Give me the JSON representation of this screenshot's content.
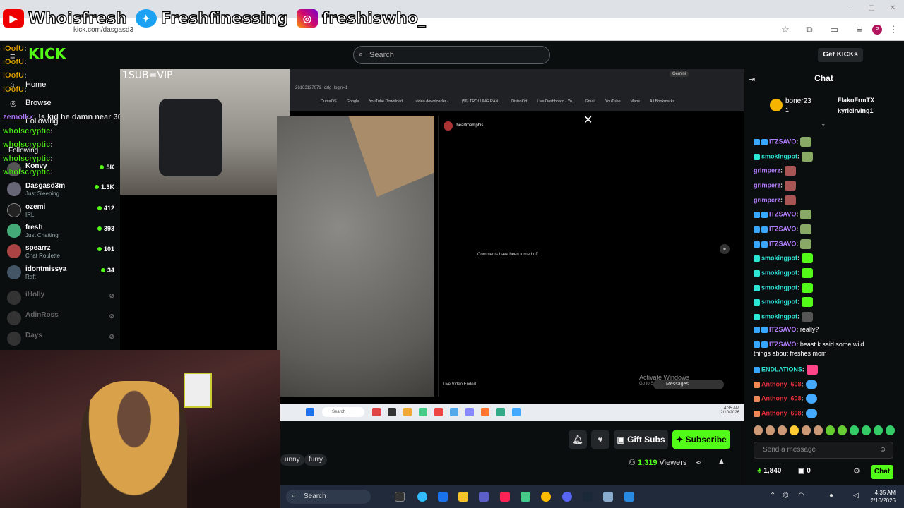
{
  "browser": {
    "url": "kick.com/dasgasd3",
    "profile_letter": "P"
  },
  "social": {
    "youtube": "Whoisfresh",
    "twitter": "Freshfinessing",
    "instagram": "freshiswho_"
  },
  "kick": {
    "search_placeholder": "Search",
    "get_kicks": "Get KICKs",
    "home": "Home",
    "browse": "Browse",
    "following": "Following"
  },
  "sidebar": {
    "channels": [
      {
        "name": "Konvy",
        "category": "",
        "viewers": "5K",
        "live": true
      },
      {
        "name": "Dasgasd3m",
        "category": "Just Sleeping",
        "viewers": "1.3K",
        "live": true
      },
      {
        "name": "ozemi",
        "category": "IRL",
        "viewers": "412",
        "live": true
      },
      {
        "name": "fresh",
        "category": "Just Chatting",
        "viewers": "393",
        "live": true
      },
      {
        "name": "spearrz",
        "category": "Chat Roulette",
        "viewers": "101",
        "live": true
      },
      {
        "name": "idontmissya",
        "category": "Raft",
        "viewers": "34",
        "live": true
      },
      {
        "name": "iHolly",
        "category": "",
        "viewers": "",
        "live": false
      },
      {
        "name": "AdinRoss",
        "category": "",
        "viewers": "",
        "live": false
      },
      {
        "name": "Days",
        "category": "",
        "viewers": "",
        "live": false
      }
    ]
  },
  "overlay_chat": [
    {
      "user": "iOofU",
      "text": ":"
    },
    {
      "user": "iOofU",
      "text": ":"
    },
    {
      "user": "iOofU",
      "text": ":"
    },
    {
      "user": "iOofU",
      "text": ":"
    },
    {
      "user": "zemolkx",
      "text": ": !s kid he damn near 30"
    },
    {
      "user": "wholscryptic",
      "text": ":"
    },
    {
      "user": "wholscryptic",
      "text": ":"
    },
    {
      "user": "wholscryptic",
      "text": ":"
    },
    {
      "user": "wholscryptic",
      "text": ":"
    }
  ],
  "video": {
    "overlay_text": "1SUB=VIP",
    "inner_url": "2616312707&_cslg_login=1",
    "bookmarks": [
      "DumaOS",
      "Google",
      "YouTube Download...",
      "video downloader -...",
      "(56) TROLLING RAN...",
      "DistroKid",
      "Live Dashboard - Yo...",
      "Gmail",
      "YouTube",
      "Maps",
      "All Bookmarks"
    ],
    "ig_user": "iheartmemphis",
    "ig_comments": "Comments have been turned off.",
    "ig_ended": "Live Video Ended",
    "activate": "Activate Windows",
    "activate_sub": "Go to Settings to activate Windows.",
    "messages": "Messages",
    "inner_search": "Search",
    "inner_time": "4:35 AM",
    "inner_date": "2/10/2026",
    "gemini": "Gemini"
  },
  "stream": {
    "gift_subs": "Gift Subs",
    "subscribe": "Subscribe",
    "tags": [
      "unny",
      "furry"
    ],
    "viewers": "1,319",
    "viewers_label": "Viewers"
  },
  "chat": {
    "title": "Chat",
    "pinned": [
      {
        "user": "boner23",
        "count": "1"
      },
      {
        "user": "FlakoFrmTX",
        "count": "1"
      },
      {
        "user": "kyrieirving1",
        "count": "1"
      }
    ],
    "messages": [
      {
        "user": "ITZSAVO",
        "color": "#b37dff",
        "text": ""
      },
      {
        "user": "smokingpot",
        "color": "#2ee6d6",
        "text": ""
      },
      {
        "user": "grimperz",
        "color": "#b37dff",
        "text": ""
      },
      {
        "user": "grimperz",
        "color": "#b37dff",
        "text": ""
      },
      {
        "user": "grimperz",
        "color": "#b37dff",
        "text": ""
      },
      {
        "user": "ITZSAVO",
        "color": "#b37dff",
        "text": ""
      },
      {
        "user": "ITZSAVO",
        "color": "#b37dff",
        "text": ""
      },
      {
        "user": "ITZSAVO",
        "color": "#b37dff",
        "text": ""
      },
      {
        "user": "smokingpot",
        "color": "#2ee6d6",
        "text": ""
      },
      {
        "user": "smokingpot",
        "color": "#2ee6d6",
        "text": ""
      },
      {
        "user": "smokingpot",
        "color": "#2ee6d6",
        "text": ""
      },
      {
        "user": "smokingpot",
        "color": "#2ee6d6",
        "text": ""
      },
      {
        "user": "smokingpot",
        "color": "#2ee6d6",
        "text": ""
      },
      {
        "user": "ITZSAVO",
        "color": "#b37dff",
        "text": "really?"
      },
      {
        "user": "ITZSAVO",
        "color": "#b37dff",
        "text": "beast k said some wild"
      },
      {
        "user": "",
        "color": "#ffffff",
        "text": "things about freshes mom"
      },
      {
        "user": "ENDLATIONS",
        "color": "#2ee6d6",
        "text": ""
      },
      {
        "user": "Anthony_608",
        "color": "#e62c3b",
        "text": ""
      },
      {
        "user": "Anthony_608",
        "color": "#e62c3b",
        "text": ""
      },
      {
        "user": "Anthony_608",
        "color": "#e62c3b",
        "text": ""
      }
    ],
    "send_placeholder": "Send a message",
    "kicks": "1,840",
    "gifts": "0",
    "chat_button": "Chat"
  },
  "taskbar": {
    "search": "Search",
    "time": "4:35 AM",
    "date": "2/10/2026"
  },
  "colors": {
    "kick_green": "#53fc18",
    "background": "#0b0e0f"
  }
}
